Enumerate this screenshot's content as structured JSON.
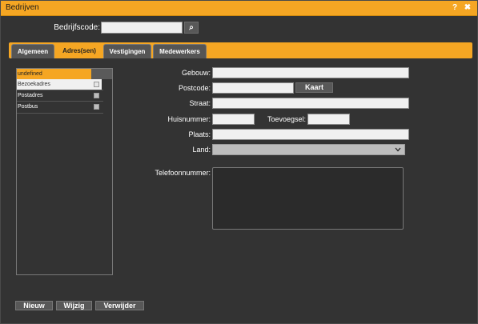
{
  "window": {
    "title": "Bedrijven",
    "help_label": "?",
    "close_label": "✖"
  },
  "search": {
    "label": "Bedrijfscode:",
    "value": "",
    "placeholder": "",
    "button_label": "⌕"
  },
  "tabs": [
    {
      "label": "Algemeen",
      "active": false
    },
    {
      "label": "Adres(sen)",
      "active": true
    },
    {
      "label": "Vestigingen",
      "active": false
    },
    {
      "label": "Medewerkers",
      "active": false
    }
  ],
  "address_list": {
    "items": [
      {
        "label": "undefined",
        "selected": true
      },
      {
        "label": "Bezoekadres",
        "checked": false
      },
      {
        "label": "Postadres",
        "checked": false
      },
      {
        "label": "Postbus",
        "checked": false
      }
    ]
  },
  "form": {
    "gebouw": {
      "label": "Gebouw:",
      "value": ""
    },
    "postcode": {
      "label": "Postcode:",
      "value": ""
    },
    "kaart_button": "Kaart",
    "straat": {
      "label": "Straat:",
      "value": ""
    },
    "huisnummer": {
      "label": "Huisnummer:",
      "value": ""
    },
    "toevoegsel": {
      "label": "Toevoegsel:",
      "value": ""
    },
    "plaats": {
      "label": "Plaats:",
      "value": ""
    },
    "land": {
      "label": "Land:",
      "value": ""
    },
    "telefoonnummer": {
      "label": "Telefoonnummer:",
      "value": ""
    }
  },
  "actions": {
    "new": "Nieuw",
    "edit": "Wijzig",
    "delete": "Verwijder"
  },
  "colors": {
    "accent": "#f5a623",
    "background": "#333333",
    "button": "#585858"
  }
}
